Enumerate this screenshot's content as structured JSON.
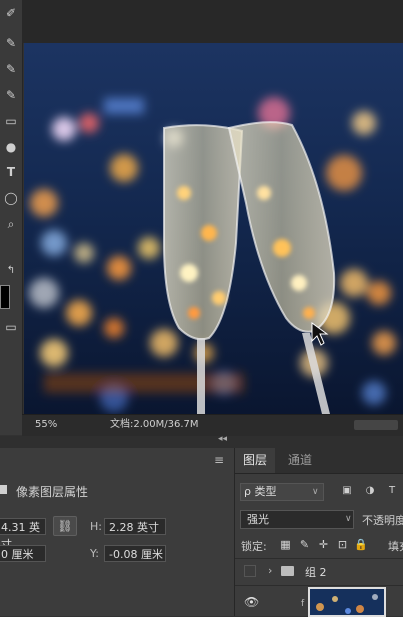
{
  "toolbar": {
    "tools": [
      "brush-icon",
      "pencil-icon",
      "pen-icon",
      "brush-icon",
      "gradient-icon",
      "blur-icon",
      "type-icon",
      "ellipse-icon",
      "zoom-icon",
      "swap-colors-icon",
      "foreground-color",
      "background-color",
      "quick-mask-icon"
    ],
    "type_glyph": "T"
  },
  "status": {
    "zoom": "55%",
    "doc_size": "文档:2.00M/36.7M"
  },
  "properties": {
    "title": "像素图层属性",
    "w_value": "4.31 英寸",
    "h_label": "H:",
    "h_value": "2.28 英寸",
    "x_value": "0 厘米",
    "y_label": "Y:",
    "y_value": "-0.08 厘米"
  },
  "layers_panel": {
    "tabs": [
      "图层",
      "通道"
    ],
    "filter_label": "ρ 类型",
    "blend_mode": "强光",
    "opacity_label": "不透明度",
    "lock_label": "锁定:",
    "fill_label": "填充",
    "group_name": "组 2",
    "layer_prefix": "f"
  },
  "colors": {
    "accent": "#dedede",
    "panel_bg": "#3c3c3c",
    "canvas_bg": "#0a1a3a"
  }
}
